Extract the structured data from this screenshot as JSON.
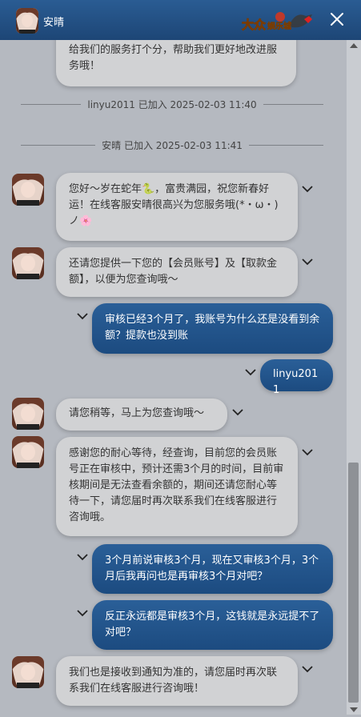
{
  "header": {
    "agent_name": "安晴",
    "logo_text": "大众娱乐城",
    "close_icon": "close-icon"
  },
  "messages": {
    "m0_text": "给我们的服务打个分，帮助我们更好地改进服务哦！",
    "sys1": "linyu2011 已加入 2025-02-03 11:40",
    "sys2": "安晴 已加入 2025-02-03 11:41",
    "m1_text": "您好～岁在蛇年🐍，富贵满园，祝您新春好运！在线客服安晴很高兴为您服务哦(*・ω・)ノ🌸",
    "m2_text": "还请您提供一下您的【会员账号】及【取款金额】，以便为您查询哦～",
    "m3_text": "审核已经3个月了，我账号为什么还是没看到余额？提款也没到账",
    "m4_text": "linyu2011",
    "m5_text": "请您稍等，马上为您查询哦～",
    "m6_text": "感谢您的耐心等待，经查询，目前您的会员账号正在审核中，预计还需3个月的时间，目前审核期间是无法查看余额的，期间还请您耐心等待一下，请您届时再次联系我们在线客服进行咨询哦。",
    "m7_text": "3个月前说审核3个月，现在又审核3个月，3个月后我再问也是再审核3个月对吧？",
    "m8_text": "反正永远都是审核3个月，这钱就是永远提不了对吧？",
    "m9_text": "我们也是接收到通知为准的，请您届时再次联系我们在线客服进行咨询哦！"
  },
  "colors": {
    "header_bg": "#1f4b7d",
    "page_bg": "#b5b9c0",
    "incoming_bubble": "#d1d2d4",
    "outgoing_bubble": "#235489"
  }
}
